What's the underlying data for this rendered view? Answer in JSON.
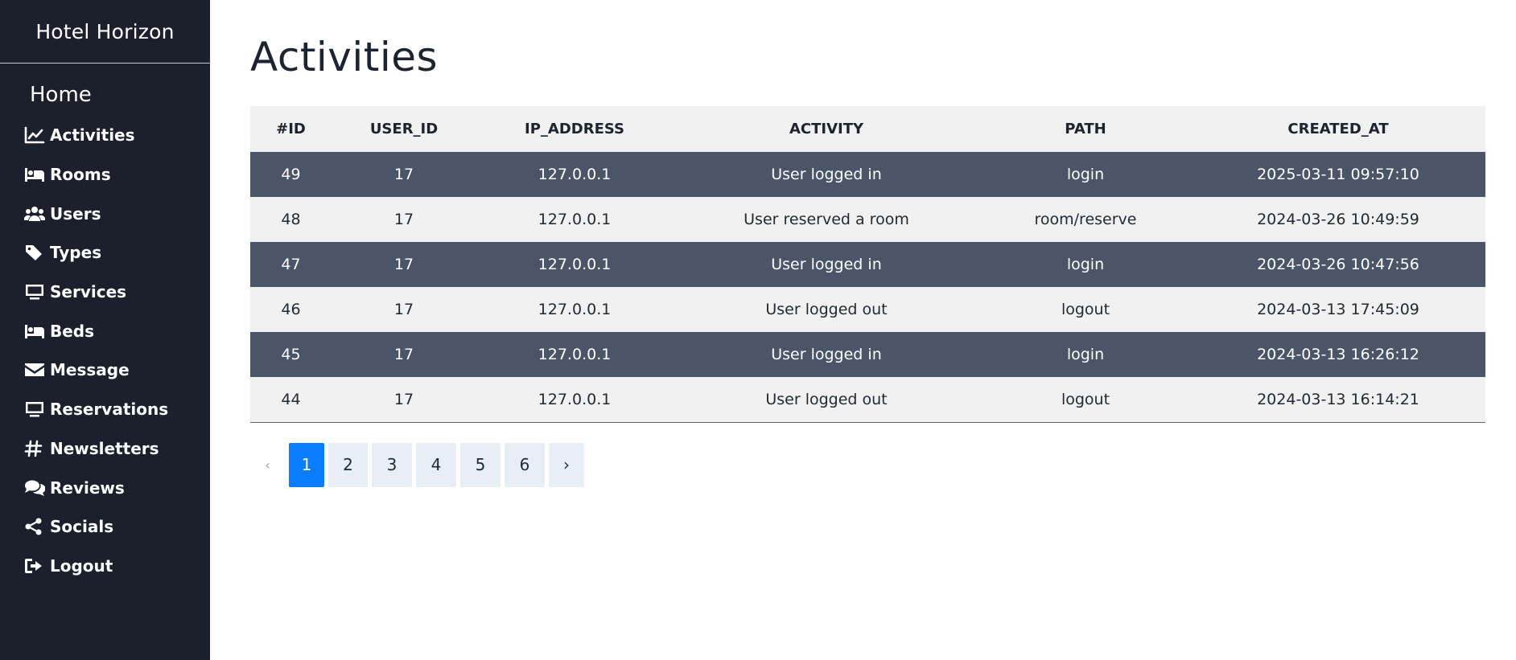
{
  "sidebar": {
    "brand": "Hotel Horizon",
    "home": "Home",
    "items": [
      {
        "label": "Activities",
        "icon": "chart-line-icon"
      },
      {
        "label": "Rooms",
        "icon": "bed-icon"
      },
      {
        "label": "Users",
        "icon": "users-icon"
      },
      {
        "label": "Types",
        "icon": "tag-icon"
      },
      {
        "label": "Services",
        "icon": "desktop-icon"
      },
      {
        "label": "Beds",
        "icon": "bed-icon"
      },
      {
        "label": "Message",
        "icon": "envelope-icon"
      },
      {
        "label": "Reservations",
        "icon": "desktop-icon"
      },
      {
        "label": "Newsletters",
        "icon": "hashtag-icon"
      },
      {
        "label": "Reviews",
        "icon": "comments-icon"
      },
      {
        "label": "Socials",
        "icon": "share-icon"
      },
      {
        "label": "Logout",
        "icon": "sign-out-icon"
      }
    ]
  },
  "main": {
    "title": "Activities",
    "table": {
      "columns": [
        "#ID",
        "USER_ID",
        "IP_ADDRESS",
        "ACTIVITY",
        "PATH",
        "CREATED_AT"
      ],
      "rows": [
        [
          "49",
          "17",
          "127.0.0.1",
          "User logged in",
          "login",
          "2025-03-11 09:57:10"
        ],
        [
          "48",
          "17",
          "127.0.0.1",
          "User reserved a room",
          "room/reserve",
          "2024-03-26 10:49:59"
        ],
        [
          "47",
          "17",
          "127.0.0.1",
          "User logged in",
          "login",
          "2024-03-26 10:47:56"
        ],
        [
          "46",
          "17",
          "127.0.0.1",
          "User logged out",
          "logout",
          "2024-03-13 17:45:09"
        ],
        [
          "45",
          "17",
          "127.0.0.1",
          "User logged in",
          "login",
          "2024-03-13 16:26:12"
        ],
        [
          "44",
          "17",
          "127.0.0.1",
          "User logged out",
          "logout",
          "2024-03-13 16:14:21"
        ]
      ]
    },
    "pagination": {
      "prev": "‹",
      "pages": [
        "1",
        "2",
        "3",
        "4",
        "5",
        "6"
      ],
      "current": "1",
      "next": "›"
    }
  },
  "colors": {
    "sidebar_bg": "#1b202c",
    "row_dark": "#4a5568",
    "row_light": "#f1f1f1",
    "accent": "#0a7dff"
  }
}
